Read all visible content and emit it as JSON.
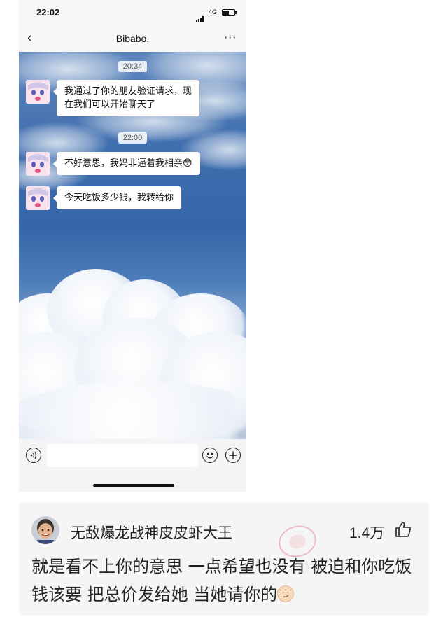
{
  "status_bar": {
    "time": "22:02",
    "network": "4G"
  },
  "navbar": {
    "back_icon": "chevron-left",
    "title": "Bibabo.",
    "more_icon": "ellipsis"
  },
  "chat": {
    "messages": [
      {
        "timestamp": "20:34",
        "text": "我通过了你的朋友验证请求，现\n在我们可以开始聊天了"
      },
      {
        "timestamp": "22:00",
        "text": "不好意思，我妈非逼着我相亲😳"
      },
      {
        "text": "今天吃饭多少钱，我转给你"
      }
    ]
  },
  "input_bar": {
    "voice_icon": "voice",
    "emoji_icon": "smile",
    "add_icon": "plus"
  },
  "comment": {
    "username": "无敌爆龙战神皮皮虾大王",
    "likes": "1.4万",
    "like_icon": "thumbs-up",
    "text": "就是看不上你的意思 一点希望也没有 被迫和你吃饭 钱该要 把总价发给她 当她请你的",
    "watermark": "神评"
  },
  "colors": {
    "sky_top": "#5d86bd",
    "bubble": "#ffffff",
    "card_bg": "#f5f5f5",
    "watermark": "#e2586b"
  }
}
